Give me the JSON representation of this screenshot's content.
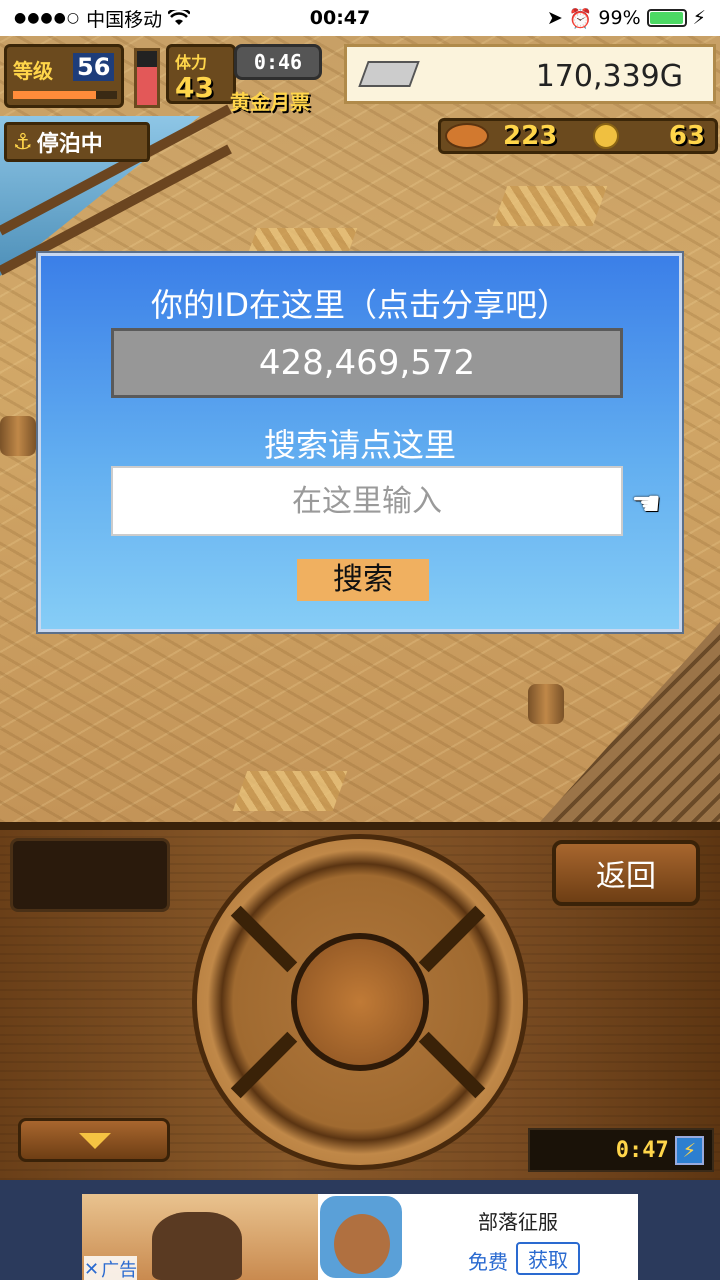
{
  "status_bar": {
    "signal": "●●●●○",
    "carrier": "中国移动",
    "wifi_icon": "wifi-icon",
    "time": "00:47",
    "battery_percent": "99%",
    "battery_level": 0.99
  },
  "hud": {
    "level_label": "等级",
    "level": "56",
    "level_progress": 0.8,
    "stamina_level": 0.7,
    "stamina_label": "体力",
    "stamina": "43",
    "timer": "0:46",
    "ticket_label": "黄金月票",
    "gold": "170,339G",
    "status": "停泊中",
    "food": "223",
    "coins": "63"
  },
  "dialog": {
    "title": "你的ID在这里（点击分享吧）",
    "player_id": "428,469,572",
    "search_hint": "搜索请点这里",
    "search_placeholder": "在这里输入",
    "search_button": "搜索"
  },
  "controls": {
    "back_button": "返回",
    "clock": "0:47"
  },
  "ad": {
    "title": "部落征服",
    "free": "免费",
    "get_button": "获取",
    "label": "广告",
    "close": "✕"
  },
  "colors": {
    "dialog_top": "#3b7fe8",
    "dialog_bottom": "#86cdf6",
    "search_button": "#f0b060",
    "id_field": "#979797",
    "hud_gold": "#ffd54a"
  }
}
